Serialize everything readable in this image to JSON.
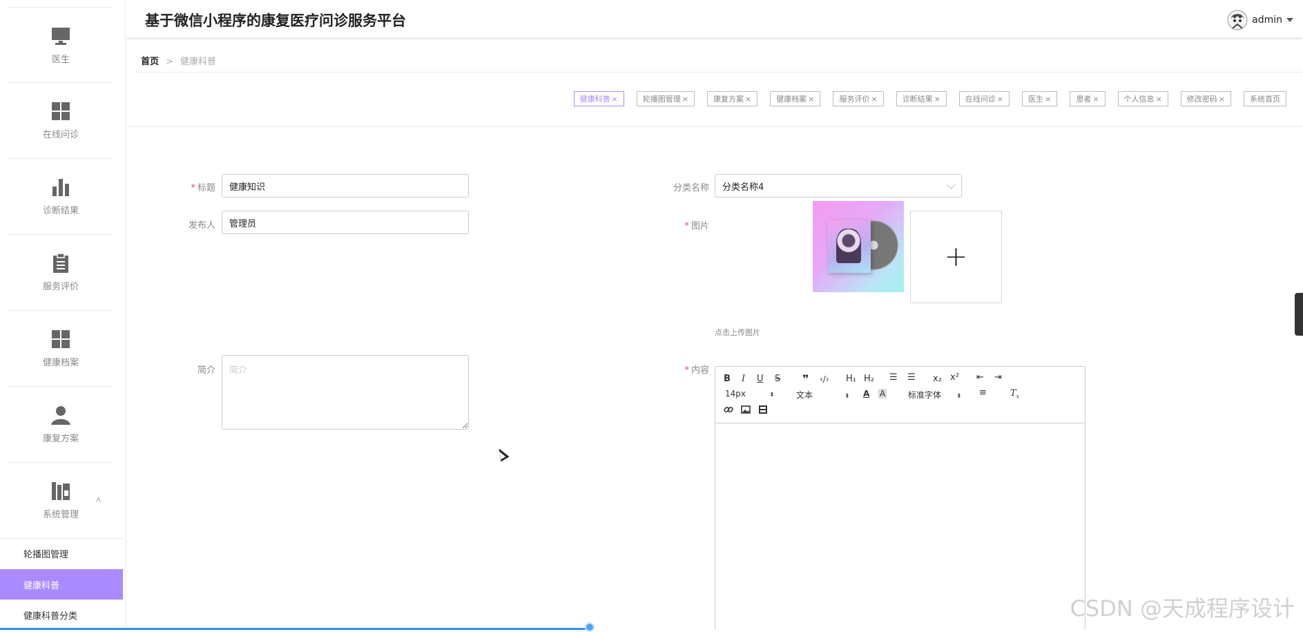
{
  "app": {
    "title": "基于微信小程序的康复医疗问诊服务平台"
  },
  "user": {
    "name": "admin"
  },
  "sidebar": {
    "items": [
      {
        "label": "医生",
        "icon": "monitor-icon"
      },
      {
        "label": "在线问诊",
        "icon": "grid-icon"
      },
      {
        "label": "诊断结果",
        "icon": "bar-chart-icon"
      },
      {
        "label": "服务评价",
        "icon": "clipboard-icon"
      },
      {
        "label": "健康档案",
        "icon": "grid-icon"
      },
      {
        "label": "康复方案",
        "icon": "user-icon"
      },
      {
        "label": "系统管理",
        "icon": "books-icon",
        "expanded": true
      }
    ],
    "sub_items": [
      {
        "label": "轮播图管理",
        "active": false
      },
      {
        "label": "健康科普",
        "active": true
      },
      {
        "label": "健康科普分类",
        "active": false
      }
    ]
  },
  "breadcrumb": {
    "home": "首页",
    "sep": ">",
    "current": "健康科普"
  },
  "tags": [
    {
      "label": "健康科普",
      "active": true
    },
    {
      "label": "轮播图管理"
    },
    {
      "label": "康复方案"
    },
    {
      "label": "健康档案"
    },
    {
      "label": "服务评价"
    },
    {
      "label": "诊断结果"
    },
    {
      "label": "在线问诊"
    },
    {
      "label": "医生"
    },
    {
      "label": "患者"
    },
    {
      "label": "个人信息"
    },
    {
      "label": "修改密码"
    },
    {
      "label": "系统首页",
      "closable": false
    }
  ],
  "form": {
    "title": {
      "label": "标题",
      "required": true,
      "value": "健康知识"
    },
    "publisher": {
      "label": "发布人",
      "value": "管理员"
    },
    "category": {
      "label": "分类名称",
      "value": "分类名称4"
    },
    "image": {
      "label": "图片",
      "required": true,
      "hint": "点击上传图片",
      "add": "+"
    },
    "intro": {
      "label": "简介",
      "placeholder": "简介",
      "value": ""
    },
    "content": {
      "label": "内容",
      "required": true
    }
  },
  "editor": {
    "font_size": "14px",
    "block_type": "文本",
    "font_family": "标准字体"
  },
  "watermark": "CSDN @天成程序设计",
  "colors": {
    "accent": "#a98bff",
    "progress": "#2e8ff0",
    "required": "#e46"
  },
  "progress": {
    "fraction": 0.453
  }
}
